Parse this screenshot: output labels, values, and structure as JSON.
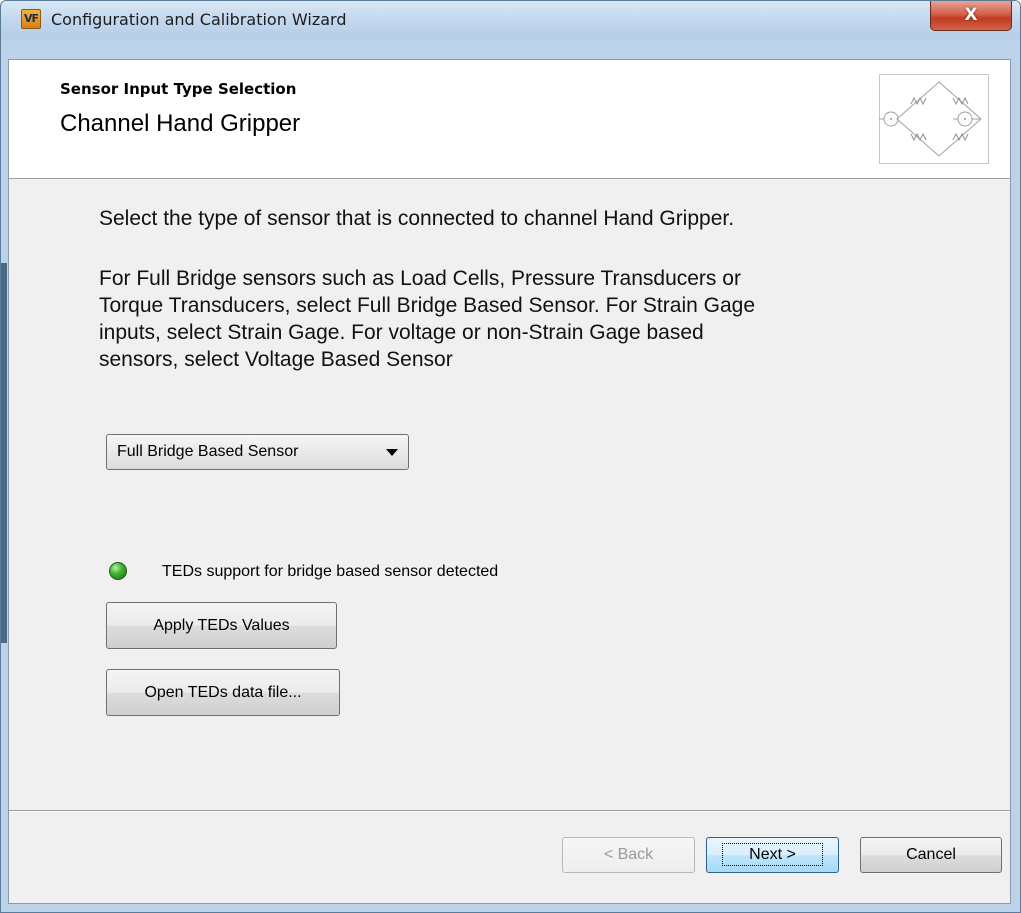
{
  "window": {
    "title": "Configuration and Calibration Wizard",
    "app_icon_text": "VF",
    "close_label": "X"
  },
  "header": {
    "subtitle": "Sensor Input Type Selection",
    "title": "Channel Hand Gripper",
    "graphic_icon": "wheatstone-bridge-icon"
  },
  "body": {
    "paragraph1": "Select the type of sensor that is connected to channel Hand Gripper.",
    "paragraph2_lines": [
      "For Full Bridge sensors such as Load Cells, Pressure Transducers or",
      "Torque Transducers, select Full Bridge Based Sensor.  For Strain Gage",
      "inputs, select Strain Gage.  For voltage or non-Strain Gage based",
      "sensors, select Voltage Based Sensor"
    ],
    "sensor_type_selected": "Full Bridge Based Sensor",
    "teds_status": "TEDs support for bridge based sensor detected",
    "teds_status_color": "#3cb82c",
    "apply_teds_label": "Apply TEDs Values",
    "open_teds_label": "Open TEDs data file..."
  },
  "footer": {
    "back_label": "< Back",
    "next_label": "Next >",
    "cancel_label": "Cancel"
  }
}
